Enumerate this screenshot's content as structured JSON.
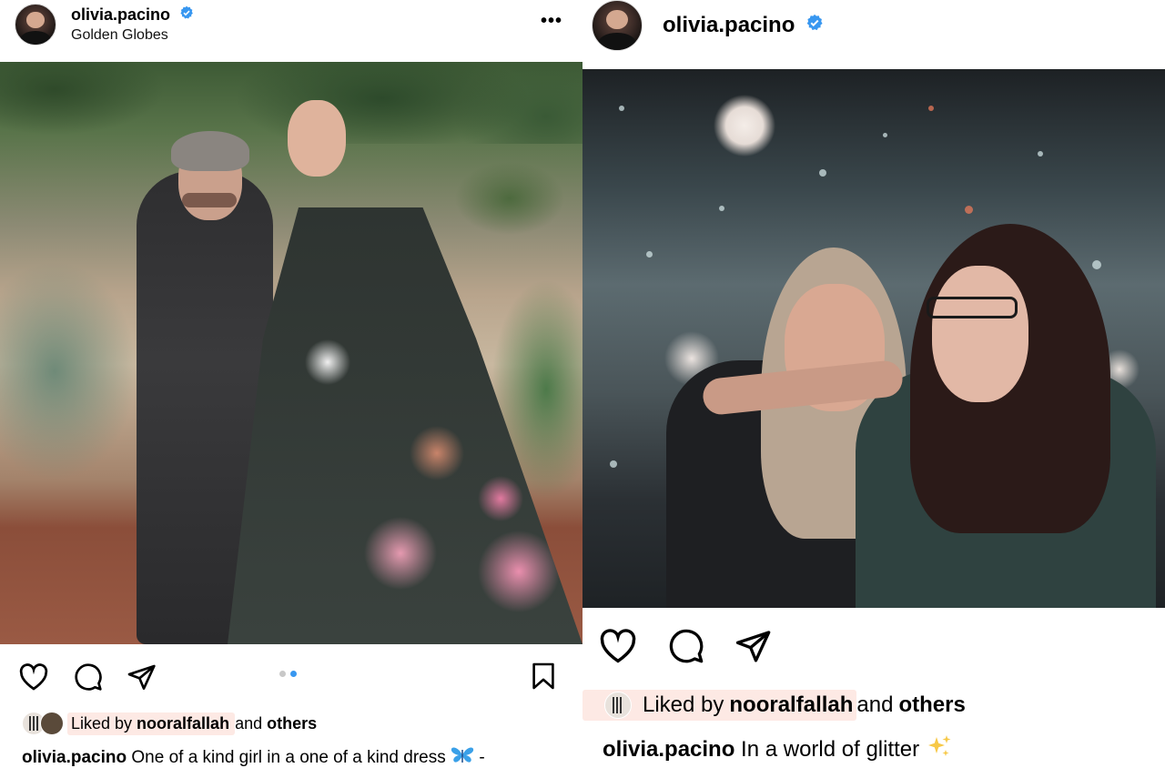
{
  "left_post": {
    "username": "olivia.pacino",
    "location": "Golden Globes",
    "more_label": "•••",
    "carousel": {
      "count": 2,
      "active_index": 1
    },
    "liked_by_prefix": "Liked by",
    "liked_by_user": "nooralfallah",
    "liked_by_and": "and",
    "liked_by_others": "others",
    "caption_user": "olivia.pacino",
    "caption_text": "One of a kind girl in a one of a kind dress",
    "caption_suffix": "-",
    "caption_emoji": "butterfly-emoji"
  },
  "right_post": {
    "username": "olivia.pacino",
    "liked_by_prefix": "Liked by",
    "liked_by_user": "nooralfallah",
    "liked_by_and": "and",
    "liked_by_others": "others",
    "caption_user": "olivia.pacino",
    "caption_text": "In a world of glitter",
    "caption_emoji": "sparkles-emoji"
  },
  "colors": {
    "verified_blue": "#3897f0",
    "like_highlight": "#fde9e4",
    "carousel_active": "#3897f0",
    "carousel_inactive": "#c8c8c8"
  },
  "icons": [
    "heart-icon",
    "comment-icon",
    "share-icon",
    "bookmark-icon",
    "verified-badge-icon",
    "more-options-icon"
  ]
}
